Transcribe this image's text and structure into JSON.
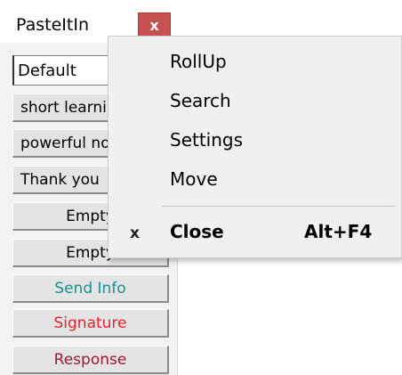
{
  "window": {
    "title": "PasteItIn",
    "close_glyph": "x",
    "profile_select": {
      "value": "Default"
    },
    "buttons": [
      {
        "label": "short learning",
        "align": "left"
      },
      {
        "label": "powerful note",
        "align": "left"
      },
      {
        "label": "Thank you",
        "align": "left"
      },
      {
        "label": "Empty",
        "align": "center"
      },
      {
        "label": "Empty",
        "align": "center"
      },
      {
        "label": "Send Info",
        "align": "center",
        "color": "#1a8f8f"
      },
      {
        "label": "Signature",
        "align": "center",
        "color": "#e8202a"
      },
      {
        "label": "Response",
        "align": "center",
        "color": "#a01830"
      }
    ]
  },
  "context_menu": {
    "items": [
      {
        "label": "RollUp"
      },
      {
        "label": "Search"
      },
      {
        "label": "Settings"
      },
      {
        "label": "Move"
      }
    ],
    "close_item": {
      "glyph": "x",
      "label": "Close",
      "accelerator": "Alt+F4"
    }
  }
}
